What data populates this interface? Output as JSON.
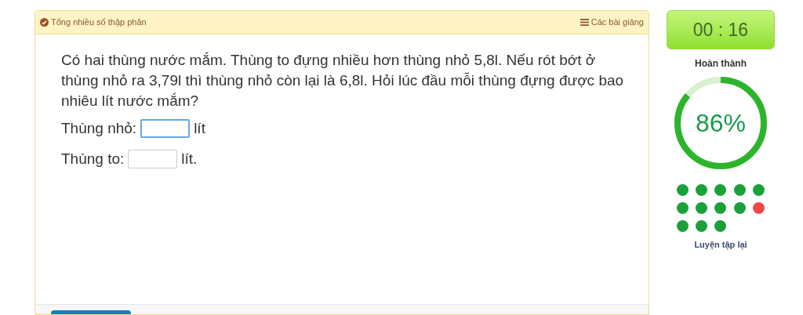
{
  "header": {
    "title": "Tổng nhiều số thập phân",
    "lessons_link": "Các bài giảng"
  },
  "question": "Có hai thùng nước mắm. Thùng to đựng nhiều hơn thùng nhỏ 5,8l. Nếu rót bớt ở thùng nhỏ ra 3,79l thì thùng nhỏ còn lại là 6,8l. Hỏi lúc đầu mỗi thùng đựng được bao nhiêu lít nước mắm?",
  "answers": [
    {
      "label": "Thùng nhỏ:",
      "unit": "lít",
      "focused": true
    },
    {
      "label": "Thùng to:",
      "unit": "lít.",
      "focused": false
    }
  ],
  "timer": "00 : 16",
  "progress": {
    "label": "Hoàn thành",
    "level": 0.86,
    "reading": "86%"
  },
  "results": [
    {
      "color": "#1aa13a"
    },
    {
      "color": "#1aa13a"
    },
    {
      "color": "#1aa13a"
    },
    {
      "color": "#1aa13a"
    },
    {
      "color": "#1aa13a"
    },
    {
      "color": "#1aa13a"
    },
    {
      "color": "#1aa13a"
    },
    {
      "color": "#1aa13a"
    },
    {
      "color": "#1aa13a"
    },
    {
      "color": "#f04848"
    },
    {
      "color": "#1aa13a"
    },
    {
      "color": "#1aa13a"
    },
    {
      "color": "#1aa13a"
    }
  ],
  "retry_link": "Luyện tập lại"
}
